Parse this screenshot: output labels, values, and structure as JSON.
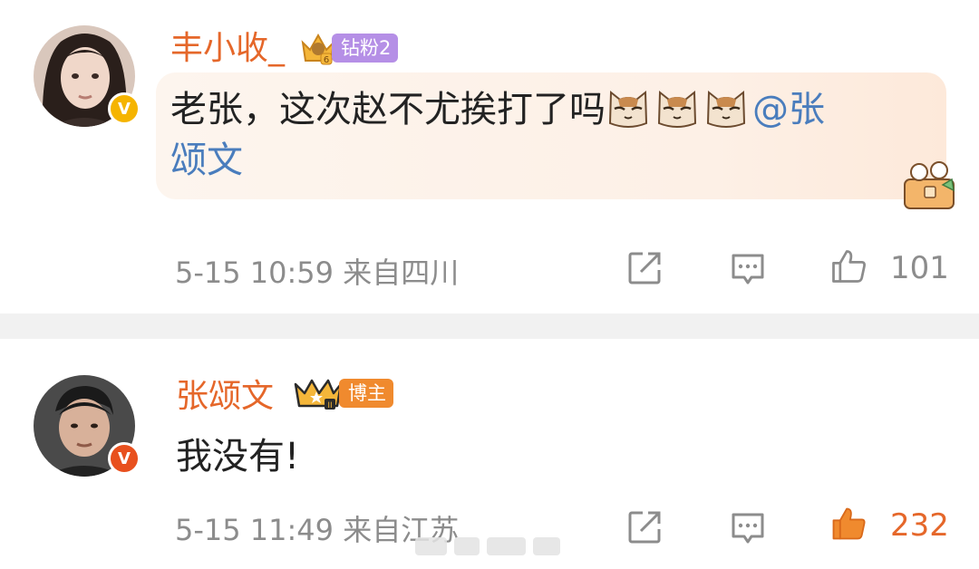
{
  "comments": [
    {
      "username": "丰小收_",
      "medal_label": "钻粉2",
      "medal_level": "6",
      "text_part1": "老张，这次赵不尤挨打了吗",
      "emoji_name": "cat-face-emoji",
      "mention_part1": "@张",
      "text_line2": "颂文",
      "meta": "5-15 10:59 来自四川",
      "likes": "101",
      "liked": false,
      "verified_badge": "V",
      "badge_color": "#f5b400"
    },
    {
      "username": "张颂文",
      "medal_label": "博主",
      "medal_level": "II",
      "text": "我没有!",
      "meta": "5-15 11:49 来自江苏",
      "likes": "232",
      "liked": true,
      "verified_badge": "V",
      "badge_color": "#e8501e"
    }
  ],
  "colors": {
    "username": "#e5672a",
    "mention": "#4a7dbd",
    "meta": "#8c8c8c",
    "liked": "#f08a2e"
  }
}
